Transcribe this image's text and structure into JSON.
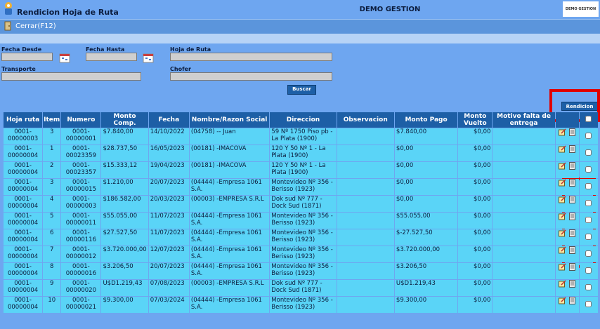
{
  "app": {
    "title": "Rendicion Hoja de Ruta",
    "center_title": "DEMO GESTION",
    "logo_text": "DEMO GESTION"
  },
  "toolbar": {
    "close_label": "Cerrar(F12)"
  },
  "filters": {
    "fecha_desde_label": "Fecha Desde",
    "fecha_hasta_label": "Fecha Hasta",
    "hoja_ruta_label": "Hoja de Ruta",
    "transporte_label": "Transporte",
    "chofer_label": "Chofer",
    "fecha_desde_value": "",
    "fecha_hasta_value": "",
    "hoja_ruta_value": "",
    "transporte_value": "",
    "chofer_value": "",
    "buscar_label": "Buscar"
  },
  "rendicion_label": "Rendicion",
  "table": {
    "headers": [
      "Hoja ruta",
      "Item",
      "Numero",
      "Monto Comp.",
      "Fecha",
      "Nombre/Razon Social",
      "Direccion",
      "Observacion",
      "Monto Pago",
      "Monto Vuelto",
      "Motivo falta de entrega",
      "",
      ""
    ],
    "rows": [
      [
        "0001-00000003",
        "3",
        "0001-00000001",
        "$7.840,00",
        "14/10/2022",
        "(04758) -- Juan",
        "59 Nº 1750 Piso pb - La Plata (1900)",
        "",
        "$7.840,00",
        "$0,00",
        ""
      ],
      [
        "0001-00000004",
        "1",
        "0001-00023359",
        "$28.737,50",
        "16/05/2023",
        "(00181) -IMACOVA",
        "120 Y 50 Nº 1 - La Plata (1900)",
        "",
        "$0,00",
        "$0,00",
        ""
      ],
      [
        "0001-00000004",
        "2",
        "0001-00023357",
        "$15.333,12",
        "19/04/2023",
        "(00181) -IMACOVA",
        "120 Y 50 Nº 1 - La Plata (1900)",
        "",
        "$0,00",
        "$0,00",
        ""
      ],
      [
        "0001-00000004",
        "3",
        "0001-00000015",
        "$1.210,00",
        "20/07/2023",
        "(04444) -Empresa 1061 S.A.",
        "Montevideo Nº 356 - Berisso (1923)",
        "",
        "$0,00",
        "$0,00",
        ""
      ],
      [
        "0001-00000004",
        "4",
        "0001-00000003",
        "$186.582,00",
        "20/03/2023",
        "(00003) -EMPRESA S.R.L",
        "Dok sud Nº 777 - Dock Sud (1871)",
        "",
        "$0,00",
        "$0,00",
        ""
      ],
      [
        "0001-00000004",
        "5",
        "0001-00000011",
        "$55.055,00",
        "11/07/2023",
        "(04444) -Empresa 1061 S.A.",
        "Montevideo Nº 356 - Berisso (1923)",
        "",
        "$55.055,00",
        "$0,00",
        ""
      ],
      [
        "0001-00000004",
        "6",
        "0001-00000116",
        "$27.527,50",
        "11/07/2023",
        "(04444) -Empresa 1061 S.A.",
        "Montevideo Nº 356 - Berisso (1923)",
        "",
        "$-27.527,50",
        "$0,00",
        ""
      ],
      [
        "0001-00000004",
        "7",
        "0001-00000012",
        "$3.720.000,00",
        "12/07/2023",
        "(04444) -Empresa 1061 S.A.",
        "Montevideo Nº 356 - Berisso (1923)",
        "",
        "$3.720.000,00",
        "$0,00",
        ""
      ],
      [
        "0001-00000004",
        "8",
        "0001-00000016",
        "$3.206,50",
        "20/07/2023",
        "(04444) -Empresa 1061 S.A.",
        "Montevideo Nº 356 - Berisso (1923)",
        "",
        "$3.206,50",
        "$0,00",
        ""
      ],
      [
        "0001-00000004",
        "9",
        "0001-00000020",
        "U$D1.219,43",
        "07/08/2023",
        "(00003) -EMPRESA S.R.L",
        "Dok sud Nº 777 - Dock Sud (1871)",
        "",
        "U$D1.219,43",
        "$0,00",
        ""
      ],
      [
        "0001-00000004",
        "10",
        "0001-00000021",
        "$9.300,00",
        "07/03/2024",
        "(04444) -Empresa 1061 S.A.",
        "Montevideo Nº 356 - Berisso (1923)",
        "",
        "$9.300,00",
        "$0,00",
        ""
      ]
    ]
  },
  "colors": {
    "background": "#6ea6f0",
    "header": "#1d5fa6",
    "row": "#5ad4f7",
    "highlight": "#e00000"
  }
}
